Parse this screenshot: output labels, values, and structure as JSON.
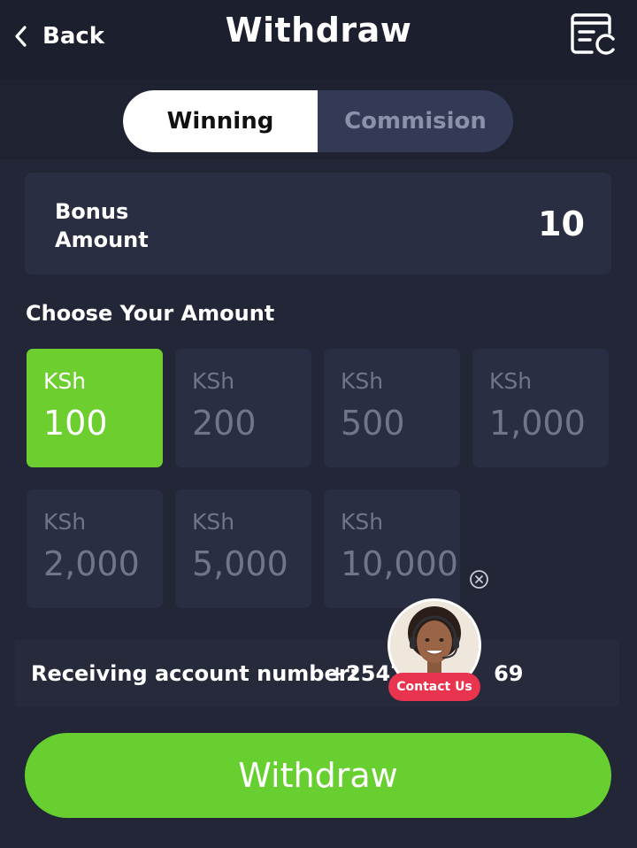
{
  "header": {
    "back_label": "Back",
    "title": "Withdraw",
    "back_icon": "chevron-left-icon",
    "history_icon": "history-list-icon"
  },
  "tabs": [
    {
      "label": "Winning",
      "active": true
    },
    {
      "label": "Commision",
      "active": false
    }
  ],
  "bonus": {
    "label": "Bonus Amount",
    "value": "10"
  },
  "choose": {
    "title": "Choose Your Amount",
    "options": [
      {
        "currency": "KSh",
        "value": "100",
        "selected": true
      },
      {
        "currency": "KSh",
        "value": "200",
        "selected": false
      },
      {
        "currency": "KSh",
        "value": "500",
        "selected": false
      },
      {
        "currency": "KSh",
        "value": "1,000",
        "selected": false
      },
      {
        "currency": "KSh",
        "value": "2,000",
        "selected": false
      },
      {
        "currency": "KSh",
        "value": "5,000",
        "selected": false
      },
      {
        "currency": "KSh",
        "value": "10,000",
        "selected": false
      }
    ]
  },
  "account": {
    "label": "Receiving account number:",
    "number": "+2547      69"
  },
  "contact": {
    "label": "Contact Us",
    "close_icon": "close-circle-icon"
  },
  "withdraw_button": {
    "label": "Withdraw"
  },
  "colors": {
    "accent_green": "#6ccf2f",
    "background": "#222636",
    "card": "#2a2e42",
    "contact_red": "#e8344e"
  }
}
